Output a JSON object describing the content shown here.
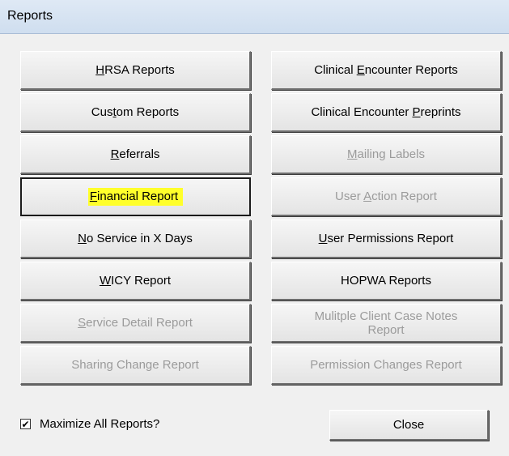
{
  "window": {
    "title": "Reports"
  },
  "colors": {
    "highlight": "#ffff2b",
    "disabled_text": "#9b9b9b"
  },
  "left_column": [
    {
      "pre": "",
      "key": "H",
      "post": "RSA Reports",
      "enabled": true
    },
    {
      "pre": "Cus",
      "key": "t",
      "post": "om Reports",
      "enabled": true
    },
    {
      "pre": "",
      "key": "R",
      "post": "eferrals",
      "enabled": true
    },
    {
      "pre": "",
      "key": "F",
      "post": "inancial Report",
      "enabled": true,
      "focused": true,
      "highlighted": true
    },
    {
      "pre": "",
      "key": "N",
      "post": "o Service in X Days",
      "enabled": true
    },
    {
      "pre": "",
      "key": "W",
      "post": "ICY Report",
      "enabled": true
    },
    {
      "pre": "",
      "key": "S",
      "post": "ervice Detail Report",
      "enabled": false
    },
    {
      "pre": "Sharing Change Report",
      "key": "",
      "post": "",
      "enabled": false
    }
  ],
  "right_column": [
    {
      "pre": "Clinical ",
      "key": "E",
      "post": "ncounter Reports",
      "enabled": true
    },
    {
      "pre": "Clinical Encounter ",
      "key": "P",
      "post": "reprints",
      "enabled": true
    },
    {
      "pre": "",
      "key": "M",
      "post": "ailing Labels",
      "enabled": false
    },
    {
      "pre": "User ",
      "key": "A",
      "post": "ction Report",
      "enabled": false
    },
    {
      "pre": "",
      "key": "U",
      "post": "ser Permissions Report",
      "enabled": true
    },
    {
      "pre": "HOPWA Reports",
      "key": "",
      "post": "",
      "enabled": true
    },
    {
      "pre": "Mulitple Client Case Notes",
      "key": "",
      "post": "",
      "line2": "Report",
      "enabled": false
    },
    {
      "pre": "Permission Changes Report",
      "key": "",
      "post": "",
      "enabled": false
    }
  ],
  "footer": {
    "maximize_label": "Maximize All Reports?",
    "maximize_checked": true,
    "check_glyph": "✔",
    "close_label": "Close"
  }
}
